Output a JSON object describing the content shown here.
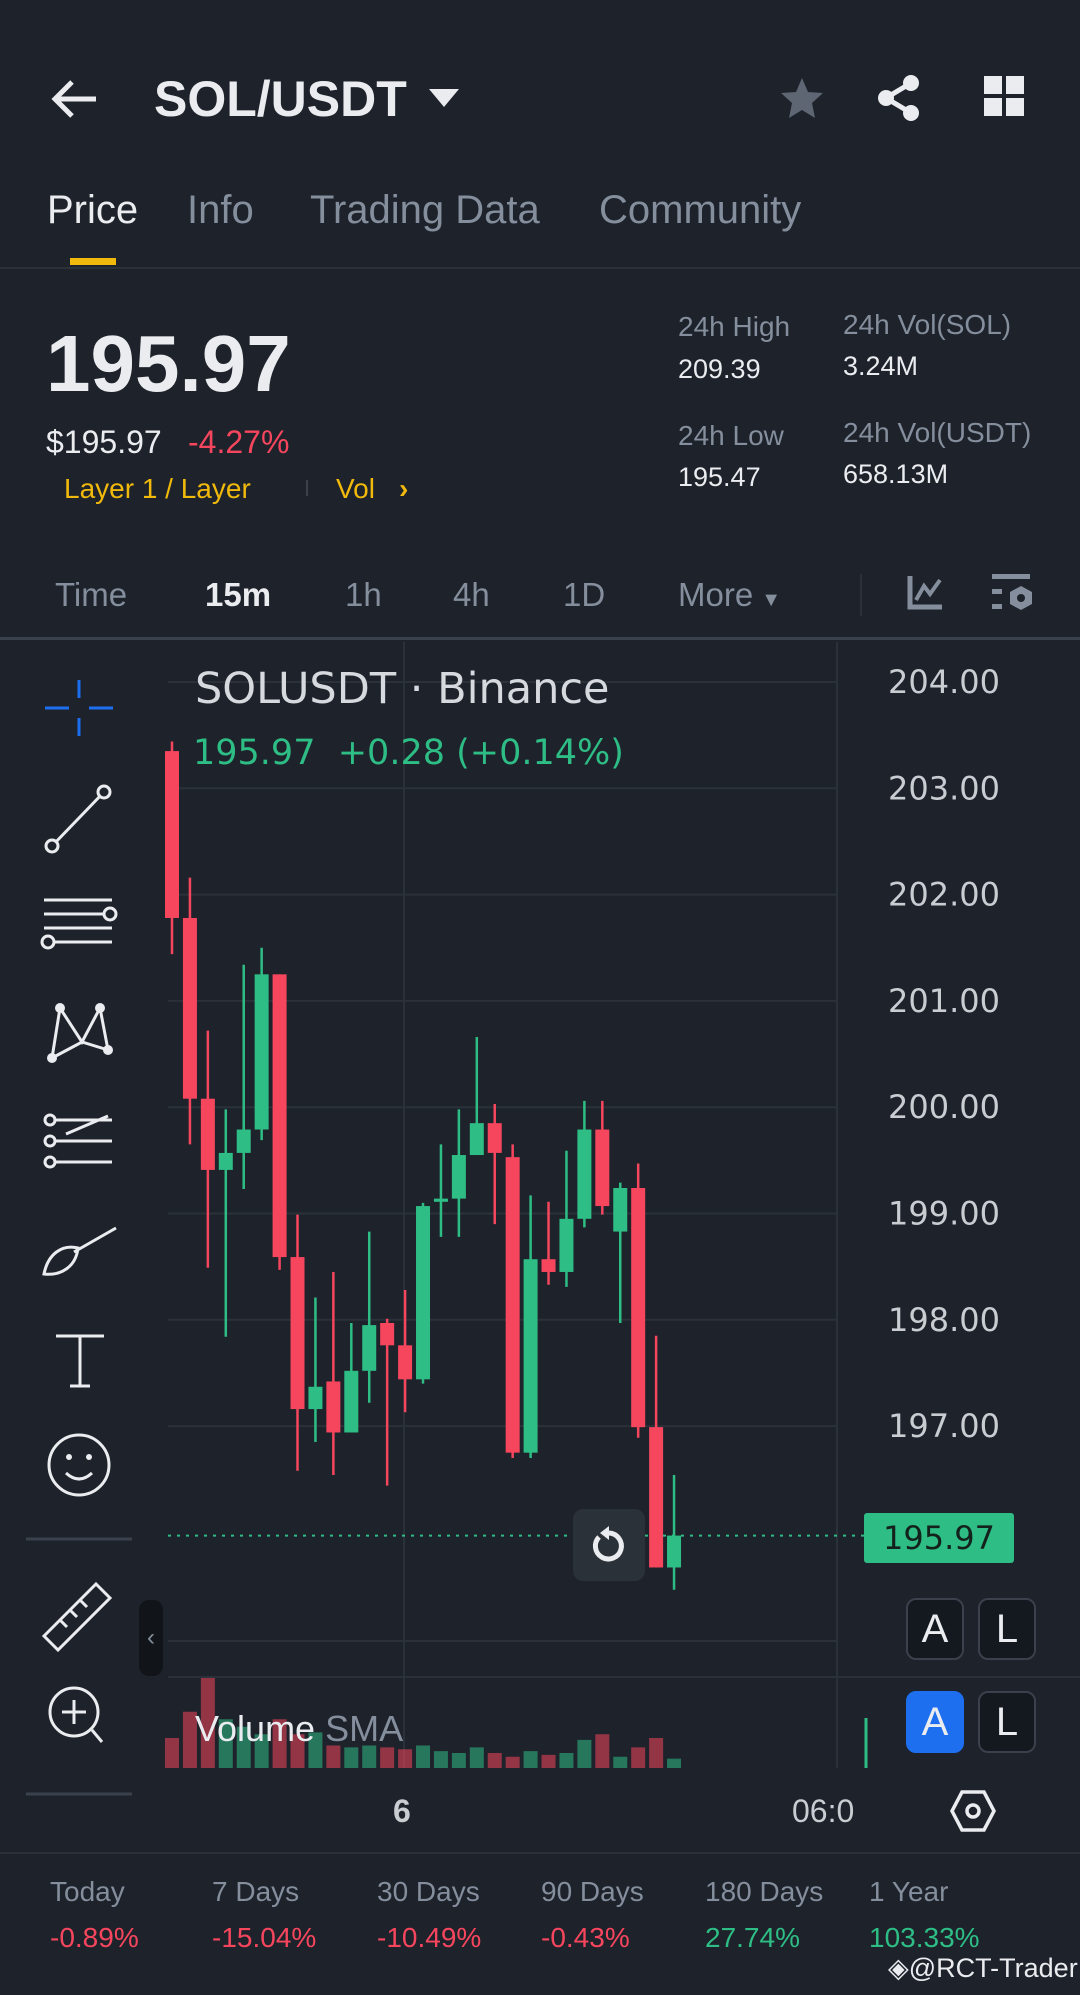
{
  "header": {
    "title": "SOL/USDT"
  },
  "tabs": [
    "Price",
    "Info",
    "Trading Data",
    "Community"
  ],
  "ticker": {
    "price": "195.97",
    "usd_price": "$195.97",
    "change_pct": "-4.27%",
    "category": "Layer 1 / Layer",
    "vol_link": "Vol",
    "vol_arrow": "›",
    "high_label": "24h High",
    "high": "209.39",
    "low_label": "24h Low",
    "low": "195.47",
    "vol_sol_label": "24h Vol(SOL)",
    "vol_sol": "3.24M",
    "vol_usdt_label": "24h Vol(USDT)",
    "vol_usdt": "658.13M"
  },
  "intervals": {
    "items": [
      "Time",
      "15m",
      "1h",
      "4h",
      "1D",
      "More"
    ],
    "selected": "15m"
  },
  "chart_data": {
    "type": "candlestick",
    "title": "SOLUSDT · Binance",
    "last": "195.97",
    "change": "+0.28",
    "change_pct": "(+0.14%)",
    "ylim": [
      195.5,
      204
    ],
    "y_ticks": [
      "204.00",
      "203.00",
      "202.00",
      "201.00",
      "200.00",
      "199.00",
      "198.00",
      "197.00"
    ],
    "x_ticks": [
      "6",
      "06:0"
    ],
    "current_price_label": "195.97",
    "volume_label": "Volume",
    "volume_sma_label": "SMA",
    "candles": [
      [
        203.35,
        203.44,
        201.44,
        201.78
      ],
      [
        201.78,
        202.16,
        199.65,
        200.08
      ],
      [
        200.08,
        200.72,
        198.49,
        199.41
      ],
      [
        199.41,
        199.98,
        197.84,
        199.57
      ],
      [
        199.57,
        201.34,
        199.23,
        199.79
      ],
      [
        199.79,
        201.5,
        199.69,
        201.25
      ],
      [
        201.25,
        201.25,
        198.47,
        198.59
      ],
      [
        198.59,
        198.99,
        196.58,
        197.16
      ],
      [
        197.16,
        198.21,
        196.85,
        197.37
      ],
      [
        197.42,
        198.45,
        196.54,
        196.94
      ],
      [
        196.94,
        197.97,
        196.94,
        197.52
      ],
      [
        197.52,
        198.83,
        197.22,
        197.95
      ],
      [
        197.97,
        198.01,
        196.44,
        197.76
      ],
      [
        197.76,
        198.28,
        197.13,
        197.44
      ],
      [
        197.44,
        199.1,
        197.4,
        199.07
      ],
      [
        199.11,
        199.65,
        198.78,
        199.14
      ],
      [
        199.14,
        199.98,
        198.78,
        199.55
      ],
      [
        199.55,
        200.66,
        199.77,
        199.85
      ],
      [
        199.85,
        200.03,
        198.9,
        199.57
      ],
      [
        199.53,
        199.65,
        196.7,
        196.75
      ],
      [
        196.75,
        199.17,
        196.7,
        198.57
      ],
      [
        198.57,
        199.11,
        198.33,
        198.45
      ],
      [
        198.45,
        199.59,
        198.31,
        198.95
      ],
      [
        198.95,
        200.06,
        198.87,
        199.79
      ],
      [
        199.79,
        200.06,
        198.99,
        199.07
      ],
      [
        198.83,
        199.29,
        197.97,
        199.24
      ],
      [
        199.24,
        199.47,
        196.89,
        196.99
      ],
      [
        196.99,
        197.85,
        195.67,
        195.67
      ],
      [
        195.67,
        196.54,
        195.46,
        195.97
      ]
    ],
    "volumes": [
      80,
      150,
      240,
      130,
      110,
      90,
      130,
      90,
      95,
      60,
      55,
      60,
      55,
      50,
      60,
      45,
      40,
      55,
      40,
      30,
      45,
      35,
      40,
      75,
      90,
      30,
      55,
      80,
      25
    ]
  },
  "scale_buttons": [
    "A",
    "L",
    "A",
    "L"
  ],
  "performance": [
    {
      "label": "Today",
      "value": "-0.89%"
    },
    {
      "label": "7 Days",
      "value": "-15.04%"
    },
    {
      "label": "30 Days",
      "value": "-10.49%"
    },
    {
      "label": "90 Days",
      "value": "-0.43%"
    },
    {
      "label": "180 Days",
      "value": "27.74%"
    },
    {
      "label": "1 Year",
      "value": "103.33%"
    }
  ],
  "watermark": "@RCT-Trader",
  "colors": {
    "up": "#2ebd85",
    "down": "#f6465d",
    "accent": "#f0b90b",
    "blue": "#1e6ff0"
  }
}
